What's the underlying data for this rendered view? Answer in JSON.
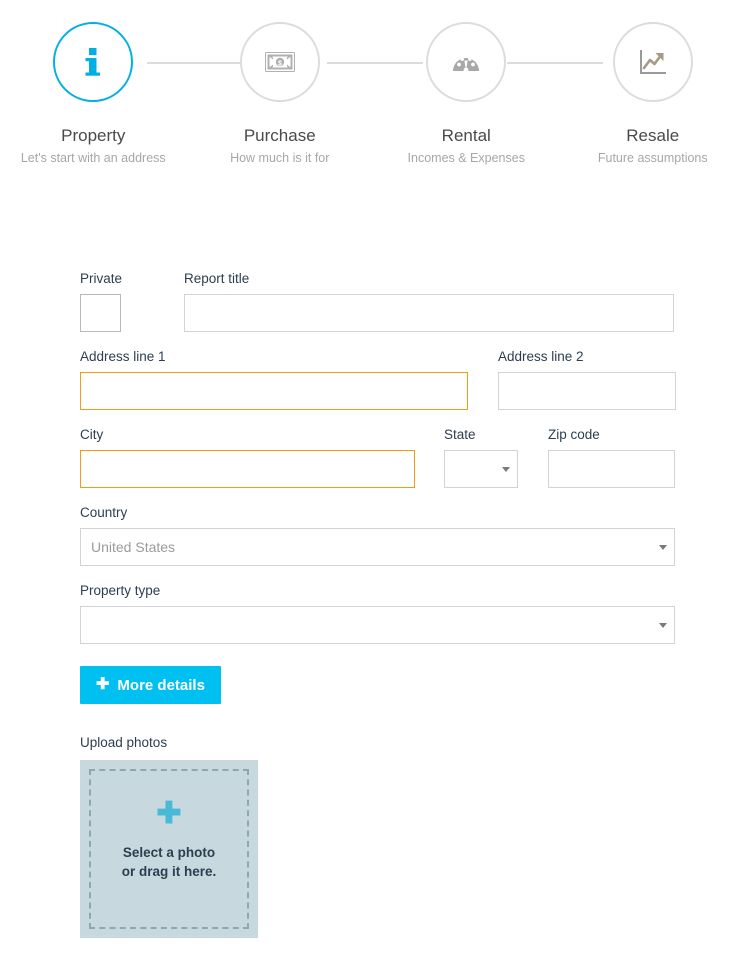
{
  "stepper": {
    "steps": [
      {
        "title": "Property",
        "subtitle": "Let's start with an address",
        "icon": "info-icon",
        "active": true
      },
      {
        "title": "Purchase",
        "subtitle": "How much is it for",
        "icon": "money-bill-icon",
        "active": false
      },
      {
        "title": "Rental",
        "subtitle": "Incomes & Expenses",
        "icon": "gauge-icon",
        "active": false
      },
      {
        "title": "Resale",
        "subtitle": "Future assumptions",
        "icon": "chart-line-up-icon",
        "active": false
      }
    ],
    "active_color": "#00b0e4",
    "inactive_color": "#dcdcdc"
  },
  "form": {
    "private": {
      "label": "Private",
      "checked": false
    },
    "report_title": {
      "label": "Report title",
      "value": "",
      "placeholder": ""
    },
    "address_line_1": {
      "label": "Address line 1",
      "value": "",
      "placeholder": "",
      "invalid": true
    },
    "address_line_2": {
      "label": "Address line 2",
      "value": "",
      "placeholder": ""
    },
    "city": {
      "label": "City",
      "value": "",
      "placeholder": "",
      "invalid": true
    },
    "state": {
      "label": "State",
      "value": "",
      "placeholder": ""
    },
    "zip_code": {
      "label": "Zip code",
      "value": "",
      "placeholder": ""
    },
    "country": {
      "label": "Country",
      "value": "United States"
    },
    "property_type": {
      "label": "Property type",
      "value": ""
    },
    "more_details_button": {
      "label": "More details",
      "icon": "plus-icon",
      "color": "#00c0f2"
    }
  },
  "upload": {
    "label": "Upload photos",
    "icon": "plus-icon",
    "line1": "Select a photo",
    "line2": "or drag it here.",
    "background": "#c7d9de",
    "plus_color": "#4ab9d6"
  }
}
